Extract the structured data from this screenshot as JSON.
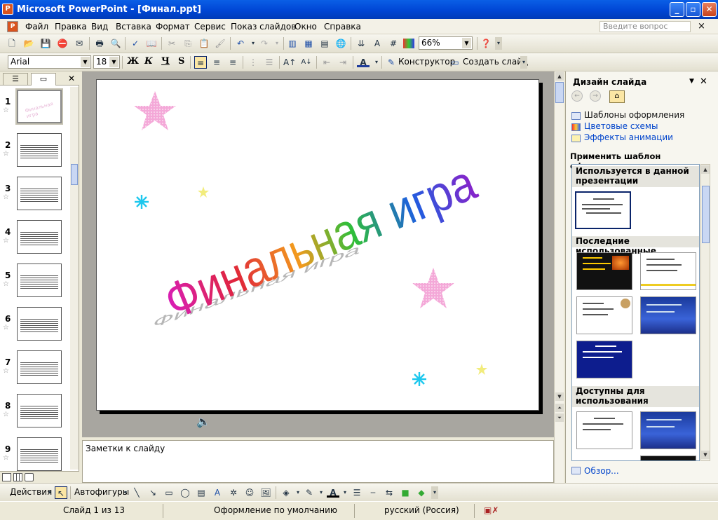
{
  "window": {
    "title": "Microsoft PowerPoint - [Финал.ppt]",
    "min": "_",
    "max": "▫",
    "close": "✕"
  },
  "menu": {
    "items": [
      "Файл",
      "Правка",
      "Вид",
      "Вставка",
      "Формат",
      "Сервис",
      "Показ слайдов",
      "Окно",
      "Справка"
    ],
    "ask_placeholder": "Введите вопрос",
    "close": "×"
  },
  "toolbar": {
    "zoom": "66%"
  },
  "formatting": {
    "font": "Arial",
    "size": "18",
    "bold": "Ж",
    "italic": "К",
    "underline": "Ч",
    "shadow": "S",
    "designer": "Конструктор",
    "new_slide": "Создать слайд"
  },
  "outline": {
    "slides": [
      {
        "num": "1",
        "heading": "",
        "body": "Финальная игра"
      },
      {
        "num": "2",
        "heading": "",
        "body": ""
      },
      {
        "num": "3",
        "heading": "",
        "body": ""
      },
      {
        "num": "4",
        "heading": "",
        "body": ""
      },
      {
        "num": "5",
        "heading": "",
        "body": ""
      },
      {
        "num": "6",
        "heading": "",
        "body": ""
      },
      {
        "num": "7",
        "heading": "",
        "body": ""
      },
      {
        "num": "8",
        "heading": "",
        "body": ""
      },
      {
        "num": "9",
        "heading": "",
        "body": ""
      }
    ]
  },
  "slide": {
    "wordart": "Финальная игра",
    "colors": {
      "star_pink": "#f4a8d8",
      "snow_cyan": "#1ec8ee",
      "star_yellow": "#f2ec7c"
    }
  },
  "notes": {
    "placeholder": "Заметки к слайду"
  },
  "taskpane": {
    "title": "Дизайн слайда",
    "links": [
      "Шаблоны оформления",
      "Цветовые схемы",
      "Эффекты анимации"
    ],
    "apply_label": "Применить шаблон оформления:",
    "sections": [
      "Используется в данной презентации",
      "Последние использованные",
      "Доступны для использования"
    ],
    "browse": "Обзор..."
  },
  "drawing": {
    "actions": "Действия",
    "autoshapes": "Автофигуры"
  },
  "status": {
    "slide": "Слайд 1 из 13",
    "design": "Оформление по умолчанию",
    "lang": "русский (Россия)"
  }
}
